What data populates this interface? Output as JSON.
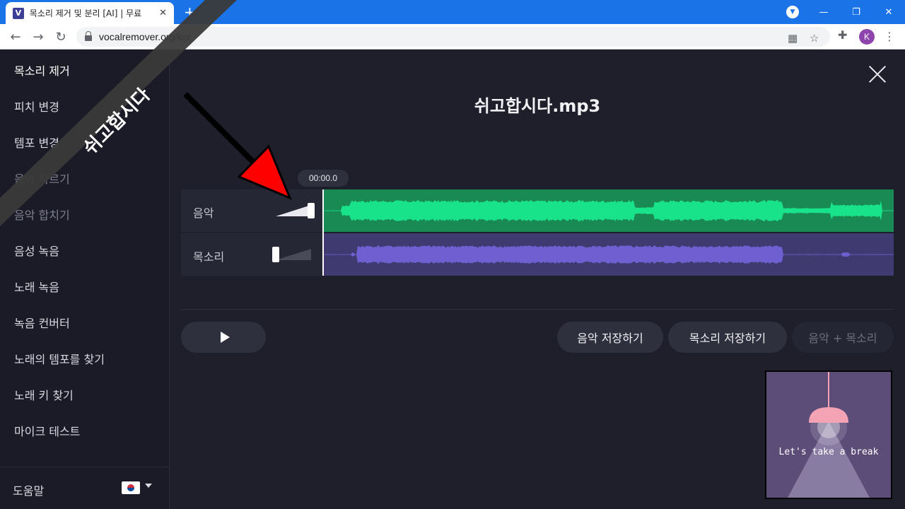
{
  "browser": {
    "tab_favicon": "V",
    "tab_title": "목소리 제거 및 분리 [AI] | 무료",
    "tab_close": "✕",
    "new_tab": "+",
    "url": "vocalremover.org/ko/",
    "avatar_letter": "K",
    "icons": [
      "back-arrow-icon",
      "forward-arrow-icon",
      "reload-icon",
      "lock-icon",
      "qr-icon",
      "star-icon",
      "puzzle-icon",
      "kebab-icon"
    ]
  },
  "sidebar": {
    "items": [
      {
        "label": "목소리 제거"
      },
      {
        "label": "피치 변경"
      },
      {
        "label": "템포 변경"
      },
      {
        "label": "음악 자르기"
      },
      {
        "label": "음악 합치기"
      },
      {
        "label": "음성 녹음"
      },
      {
        "label": "노래 녹음"
      },
      {
        "label": "녹음 컨버터"
      },
      {
        "label": "노래의 템포를 찾기"
      },
      {
        "label": "노래 키 찾기"
      },
      {
        "label": "마이크 테스트"
      }
    ],
    "help_label": "도움말"
  },
  "main": {
    "filename": "쉬고합시다.mp3",
    "time": "00:00.0",
    "tracks": [
      {
        "label": "음악",
        "volume": 1.0,
        "color": "#19e38a"
      },
      {
        "label": "목소리",
        "volume": 0.0,
        "color": "#6f5fd0"
      }
    ],
    "buttons": {
      "save_music": "음악 저장하기",
      "save_voice": "목소리 저장하기",
      "save_both": "음악 + 목소리"
    }
  },
  "overlay": {
    "banner_text": "쉬고합시다",
    "thumb_text": "Let's take a break"
  }
}
